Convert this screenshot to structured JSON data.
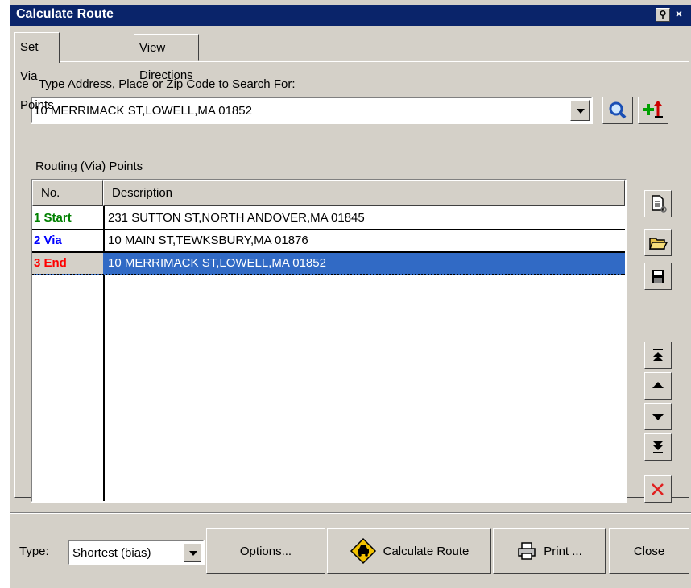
{
  "window": {
    "title": "Calculate Route",
    "pin_glyph": "⚲",
    "close_glyph": "×"
  },
  "tabs": [
    {
      "label": "Set Via Points",
      "active": true
    },
    {
      "label": "View Directions",
      "active": false
    }
  ],
  "search": {
    "label": "Type Address, Place or Zip Code to Search For:",
    "value": "10 MERRIMACK ST,LOWELL,MA 01852",
    "search_icon": "magnifier-icon",
    "add_icon": "add-point-icon"
  },
  "routing": {
    "label": "Routing (Via) Points",
    "columns": [
      "No.",
      "Description"
    ],
    "rows": [
      {
        "no": "1 Start",
        "desc": "231 SUTTON ST,NORTH ANDOVER,MA 01845",
        "color": "#008000"
      },
      {
        "no": "2 Via",
        "desc": "10 MAIN ST,TEWKSBURY,MA 01876",
        "color": "#0000ff"
      },
      {
        "no": "3 End",
        "desc": "10 MERRIMACK ST,LOWELL,MA 01852",
        "color": "#ff0000",
        "selected": true
      }
    ]
  },
  "bottom": {
    "type_label": "Type:",
    "type_value": "Shortest (bias)",
    "options_label": "Options...",
    "calculate_label": "Calculate Route",
    "print_label": "Print ...",
    "close_label": "Close"
  },
  "colors": {
    "titlebar": "#0a246a",
    "selection": "#316ac5",
    "face": "#d4d0c8"
  }
}
